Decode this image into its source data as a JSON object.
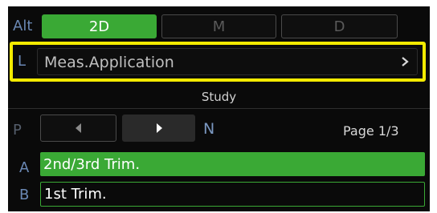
{
  "mode_row": {
    "label": "Alt",
    "tabs": [
      {
        "label": "2D"
      },
      {
        "label": "M"
      },
      {
        "label": "D"
      }
    ]
  },
  "meas_row": {
    "label": "L",
    "title": "Meas.Application",
    "chevron_icon": "chevron-right-icon"
  },
  "section": {
    "title": "Study"
  },
  "pager": {
    "prev_letter": "P",
    "next_letter": "N",
    "prev_icon": "triangle-left-icon",
    "next_icon": "triangle-right-icon",
    "page_text": "Page 1/3"
  },
  "options": [
    {
      "letter": "A",
      "label": "2nd/3rd Trim."
    },
    {
      "letter": "B",
      "label": "1st Trim."
    }
  ],
  "colors": {
    "active_green": "#3aa935",
    "highlight_yellow": "#f3ea00",
    "letter_blue": "#6a88b4"
  }
}
